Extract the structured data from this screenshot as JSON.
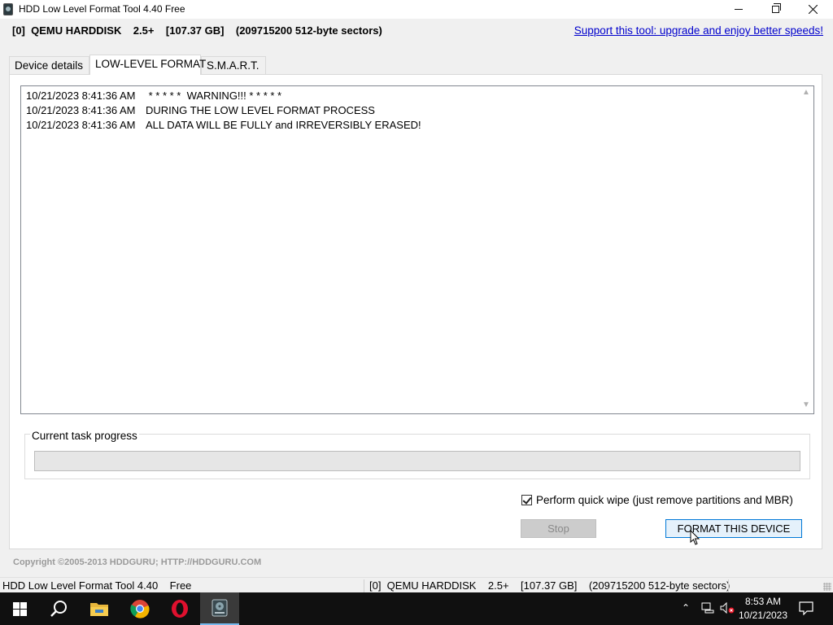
{
  "window": {
    "title": "HDD Low Level Format Tool 4.40   Free"
  },
  "header": {
    "device_summary": "[0]  QEMU HARDDISK    2.5+    [107.37 GB]    (209715200 512-byte sectors)",
    "support_link": "Support this tool: upgrade and enjoy better speeds!"
  },
  "tabs": [
    {
      "label": "Device details",
      "active": false
    },
    {
      "label": "LOW-LEVEL FORMAT",
      "active": true
    },
    {
      "label": "S.M.A.R.T.",
      "active": false
    }
  ],
  "log": {
    "lines": [
      {
        "timestamp": "10/21/2023 8:41:36 AM",
        "message": " * * * * *  WARNING!!! * * * * *"
      },
      {
        "timestamp": "10/21/2023 8:41:36 AM",
        "message": "DURING THE LOW LEVEL FORMAT PROCESS"
      },
      {
        "timestamp": "10/21/2023 8:41:36 AM",
        "message": "ALL DATA WILL BE FULLY and IRREVERSIBLY ERASED!"
      }
    ]
  },
  "progress": {
    "label": "Current task progress",
    "value": 0
  },
  "options": {
    "quick_wipe_label": "Perform quick wipe (just remove partitions and MBR)",
    "quick_wipe_checked": true
  },
  "buttons": {
    "stop": "Stop",
    "format": "FORMAT THIS DEVICE"
  },
  "footer": {
    "copyright": "Copyright ©2005-2013 HDDGURU;   HTTP://HDDGURU.COM"
  },
  "statusbar": {
    "left": "HDD Low Level Format Tool 4.40    Free",
    "right": "[0]  QEMU HARDDISK    2.5+    [107.37 GB]    (209715200 512-byte sectors)"
  },
  "taskbar": {
    "time": "8:53 AM",
    "date": "10/21/2023",
    "items": [
      "start-icon",
      "search-icon",
      "file-explorer-icon",
      "chrome-icon",
      "opera-icon",
      "hdd-format-tool-icon"
    ]
  },
  "colors": {
    "accent": "#0078d7",
    "link": "#0000cc",
    "taskbar": "#101010"
  }
}
